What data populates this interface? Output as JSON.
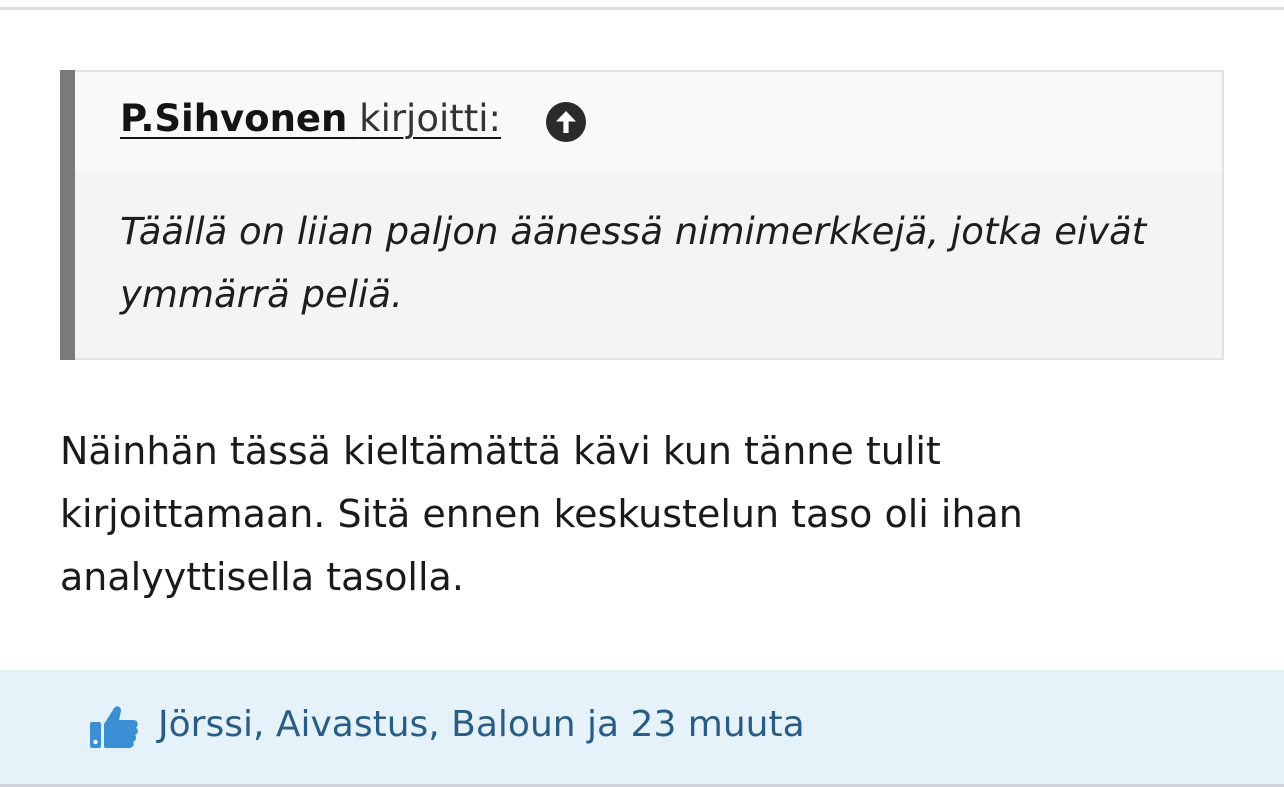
{
  "quote": {
    "author": "P.Sihvonen",
    "wrote": "kirjoitti:",
    "body": "Täällä on liian paljon äänessä nimimerkkejä, jotka eivät ymmärrä peliä."
  },
  "post": {
    "text": "Näinhän tässä kieltämättä kävi kun tänne tulit kirjoittamaan. Sitä ennen keskustelun taso oli ihan analyyttisella tasolla."
  },
  "reactions": {
    "text": "Jörssi, Aivastus, Baloun ja 23 muuta"
  },
  "icons": {
    "quote_jump": "arrow-up-circle-icon",
    "like": "thumbs-up-icon"
  },
  "colors": {
    "quote_bar": "#7b7b7b",
    "reaction_bg": "#e6f2fa",
    "reaction_text": "#2a5d86",
    "like_icon": "#3a8fd4"
  }
}
